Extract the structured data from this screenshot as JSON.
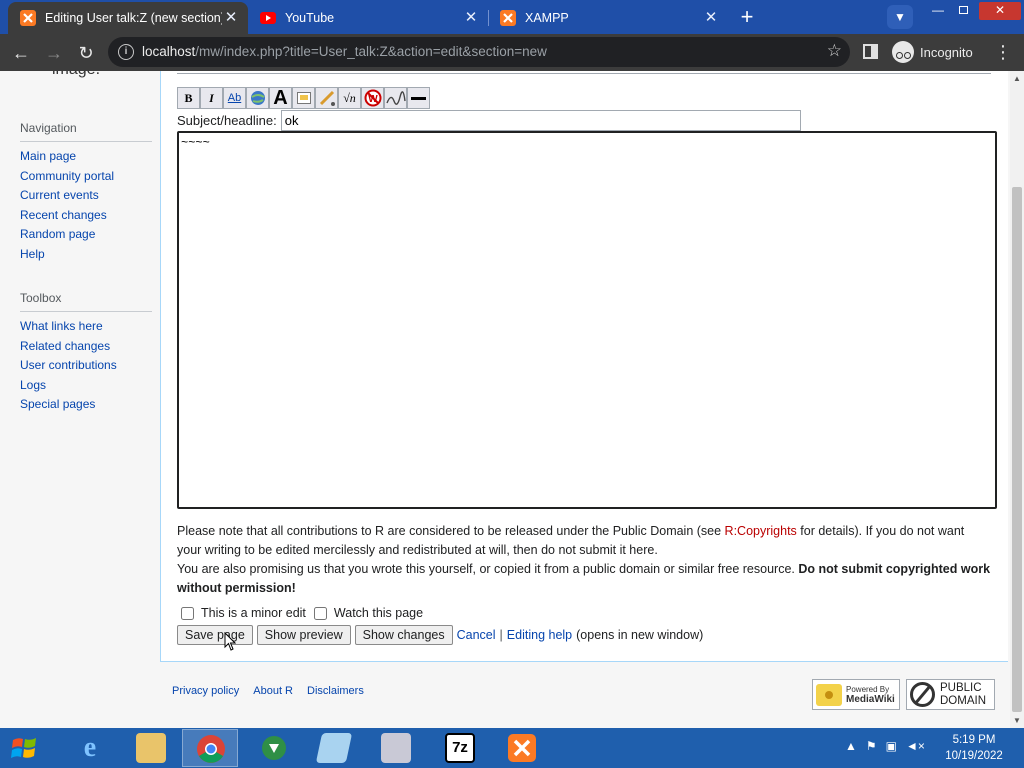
{
  "browser": {
    "tabs": [
      {
        "title": "Editing User talk:Z (new section)",
        "icon": "xampp-icon"
      },
      {
        "title": "YouTube",
        "icon": "youtube-icon"
      },
      {
        "title": "XAMPP",
        "icon": "xampp-icon"
      }
    ],
    "url_host": "localhost",
    "url_path": "/mw/index.php?title=User_talk:Z&action=edit&section=new",
    "profile_label": "Incognito"
  },
  "sidebar": {
    "logo_fragment": "image.",
    "navigation_title": "Navigation",
    "navigation": [
      "Main page",
      "Community portal",
      "Current events",
      "Recent changes",
      "Random page",
      "Help"
    ],
    "toolbox_title": "Toolbox",
    "toolbox": [
      "What links here",
      "Related changes",
      "User contributions",
      "Logs",
      "Special pages"
    ]
  },
  "editor": {
    "toolbar": [
      "bold-icon",
      "italic-icon",
      "link-icon",
      "external-link-icon",
      "headline-icon",
      "image-icon",
      "media-icon",
      "math-icon",
      "nowiki-icon",
      "signature-icon",
      "horizontal-rule-icon"
    ],
    "subject_label": "Subject/headline:",
    "subject_value": "ok",
    "body_text": "~~~~",
    "notice_1": "Please note that all contributions to R are considered to be released under the Public Domain (see ",
    "notice_link": "R:Copyrights",
    "notice_2": " for details). If you do not want your writing to be edited mercilessly and redistributed at will, then do not submit it here.",
    "notice_3": "You are also promising us that you wrote this yourself, or copied it from a public domain or similar free resource. ",
    "notice_bold": "Do not submit copyrighted work without permission!",
    "minor_edit_label": "This is a minor edit",
    "watch_label": "Watch this page",
    "save_label": "Save page",
    "preview_label": "Show preview",
    "changes_label": "Show changes",
    "cancel_label": "Cancel",
    "separator": "|",
    "help_label": "Editing help",
    "help_note": "(opens in new window)"
  },
  "footer": {
    "links": [
      "Privacy policy",
      "About R",
      "Disclaimers"
    ],
    "mediawiki_badge_small": "Powered By",
    "mediawiki_badge_name": "MediaWiki",
    "pd_badge_line1": "PUBLIC",
    "pd_badge_line2": "DOMAIN"
  },
  "taskbar": {
    "items": [
      "ie-icon",
      "file-explorer-icon",
      "chrome-icon",
      "internet-download-manager-icon",
      "notepad-icon",
      "archive-icon",
      "7zip-icon",
      "xampp-icon"
    ],
    "sevenzip_label": "7z",
    "time": "5:19 PM",
    "date": "10/19/2022"
  }
}
